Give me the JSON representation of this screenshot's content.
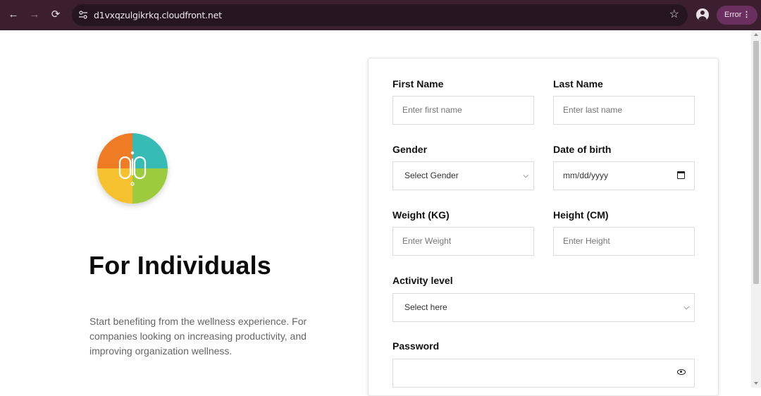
{
  "browser": {
    "url": "d1vxqzulgikrkq.cloudfront.net",
    "error_label": "Error",
    "nav_back": "←",
    "nav_forward": "→",
    "nav_reload": "⟳",
    "star": "☆",
    "menu": "⋮"
  },
  "hero": {
    "title": "For Individuals",
    "description": "Start benefiting from the wellness experience. For companies looking on increasing productivity, and improving organization wellness."
  },
  "logo_colors": [
    "#f07b25",
    "#36bcb5",
    "#f6c12f",
    "#9ccb3d"
  ],
  "form": {
    "first_name_label": "First Name",
    "first_name_placeholder": "Enter first name",
    "last_name_label": "Last Name",
    "last_name_placeholder": "Enter last name",
    "gender_label": "Gender",
    "gender_value": "Select Gender",
    "dob_label": "Date of birth",
    "dob_value": "mm/dd/yyyy",
    "weight_label": "Weight (KG)",
    "weight_placeholder": "Enter Weight",
    "height_label": "Height (CM)",
    "height_placeholder": "Enter Height",
    "activity_label": "Activity level",
    "activity_value": "Select here",
    "password_label": "Password",
    "password_value": ""
  }
}
